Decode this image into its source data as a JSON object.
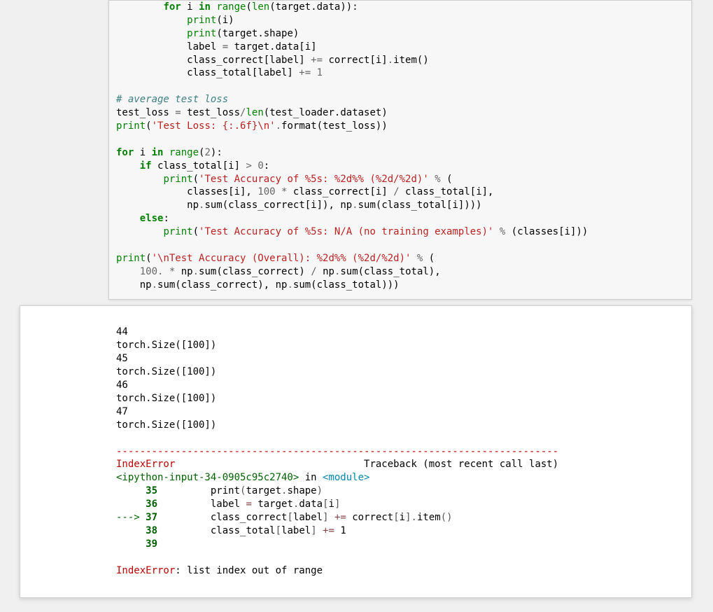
{
  "code": {
    "l1_for": "for",
    "l1_i": " i ",
    "l1_in": "in",
    "l1_range": " range",
    "l1_len": "len",
    "l1_rest": "(target.data)):",
    "l1_pre": "(",
    "l2_print": "print",
    "l2_rest": "(i)",
    "l3_print": "print",
    "l3_rest": "(target.shape)",
    "l4_l": "            label ",
    "l4_eq": "=",
    "l4_r": " target.data[i]",
    "l5_l": "            class_correct[label] ",
    "l5_op": "+=",
    "l5_m": " correct[i]",
    "l5_dot": ".",
    "l5_r": "item()",
    "l6_l": "            class_total[label] ",
    "l6_op": "+=",
    "l6_sp": " ",
    "l6_one": "1",
    "l8_comment": "# average test loss",
    "l9_l": "test_loss ",
    "l9_eq": "=",
    "l9_m": " test_loss",
    "l9_div": "/",
    "l9_len": "len",
    "l9_r": "(test_loader.dataset)",
    "l10_print": "print",
    "l10_p": "(",
    "l10_str": "'Test Loss: {:.6f}\\n'",
    "l10_dot": ".",
    "l10_r": "format(test_loss))",
    "l12_for": "for",
    "l12_i": " i ",
    "l12_in": "in",
    "l12_range": " range",
    "l12_p": "(",
    "l12_two": "2",
    "l12_r": "):",
    "l13_indent": "    ",
    "l13_if": "if",
    "l13_m": " class_total[i] ",
    "l13_gt": ">",
    "l13_sp": " ",
    "l13_zero": "0",
    "l13_r": ":",
    "l14_indent": "        ",
    "l14_print": "print",
    "l14_p": "(",
    "l14_str": "'Test Accuracy of %5s: %2d%% (%2d/%2d)'",
    "l14_sp": " ",
    "l14_pct": "%",
    "l14_r": " (",
    "l15_l": "            classes[i], ",
    "l15_100": "100",
    "l15_sp": " ",
    "l15_mul": "*",
    "l15_m": " class_correct[i] ",
    "l15_div": "/",
    "l15_r": " class_total[i],",
    "l16_l": "            np",
    "l16_dot": ".",
    "l16_m": "sum(class_correct[i]), np",
    "l16_dot2": ".",
    "l16_r": "sum(class_total[i])))",
    "l17_indent": "    ",
    "l17_else": "else",
    "l17_colon": ":",
    "l18_indent": "        ",
    "l18_print": "print",
    "l18_p": "(",
    "l18_str": "'Test Accuracy of %5s: N/A (no training examples)'",
    "l18_sp": " ",
    "l18_pct": "%",
    "l18_r": " (classes[i]))",
    "l20_print": "print",
    "l20_p": "(",
    "l20_str": "'\\nTest Accuracy (Overall): %2d%% (%2d/%2d)'",
    "l20_sp": " ",
    "l20_pct": "%",
    "l20_r": " (",
    "l21_indent": "    ",
    "l21_100": "100.",
    "l21_sp": " ",
    "l21_mul": "*",
    "l21_m1": " np",
    "l21_d1": ".",
    "l21_m2": "sum(class_correct) ",
    "l21_div": "/",
    "l21_m3": " np",
    "l21_d2": ".",
    "l21_r": "sum(class_total),",
    "l22_l": "    np",
    "l22_d1": ".",
    "l22_m": "sum(class_correct), np",
    "l22_d2": ".",
    "l22_r": "sum(class_total)))"
  },
  "output": {
    "p44": "44",
    "s1": "torch.Size([100])",
    "p45": "45",
    "s2": "torch.Size([100])",
    "p46": "46",
    "s3": "torch.Size([100])",
    "p47": "47",
    "s4": "torch.Size([100])"
  },
  "traceback": {
    "dashes": "---------------------------------------------------------------------------",
    "err_name": "IndexError",
    "tb_label": "                                Traceback (most recent call last)",
    "ipy_path": "<ipython-input-34-0905c95c2740>",
    "in_word": " in ",
    "module": "<module>",
    "ln35": "     35 ",
    "l35_print": "        print",
    "l35_p": "(",
    "l35_m": "target",
    "l35_d": ".",
    "l35_r": "shape",
    "l35_rp": ")",
    "ln36": "     36 ",
    "l36_lab": "        label ",
    "l36_eq": "=",
    "l36_m": " target",
    "l36_d": ".",
    "l36_r": "data",
    "l36_lb": "[",
    "l36_i": "i",
    "l36_rb": "]",
    "arrow": "---> ",
    "ln37": "37 ",
    "l37_cc": "        class_correct",
    "l37_lb": "[",
    "l37_lab": "label",
    "l37_rb": "]",
    "l37_sp": " ",
    "l37_op": "+=",
    "l37_m": " correct",
    "l37_lb2": "[",
    "l37_i": "i",
    "l37_rb2": "]",
    "l37_d": ".",
    "l37_item": "item",
    "l37_pp": "()",
    "ln38": "     38 ",
    "l38_ct": "        class_total",
    "l38_lb": "[",
    "l38_lab": "label",
    "l38_rb": "]",
    "l38_sp": " ",
    "l38_op": "+=",
    "l38_one": " 1",
    "ln39": "     39 ",
    "final_err": "IndexError",
    "final_msg": ": list index out of range"
  }
}
